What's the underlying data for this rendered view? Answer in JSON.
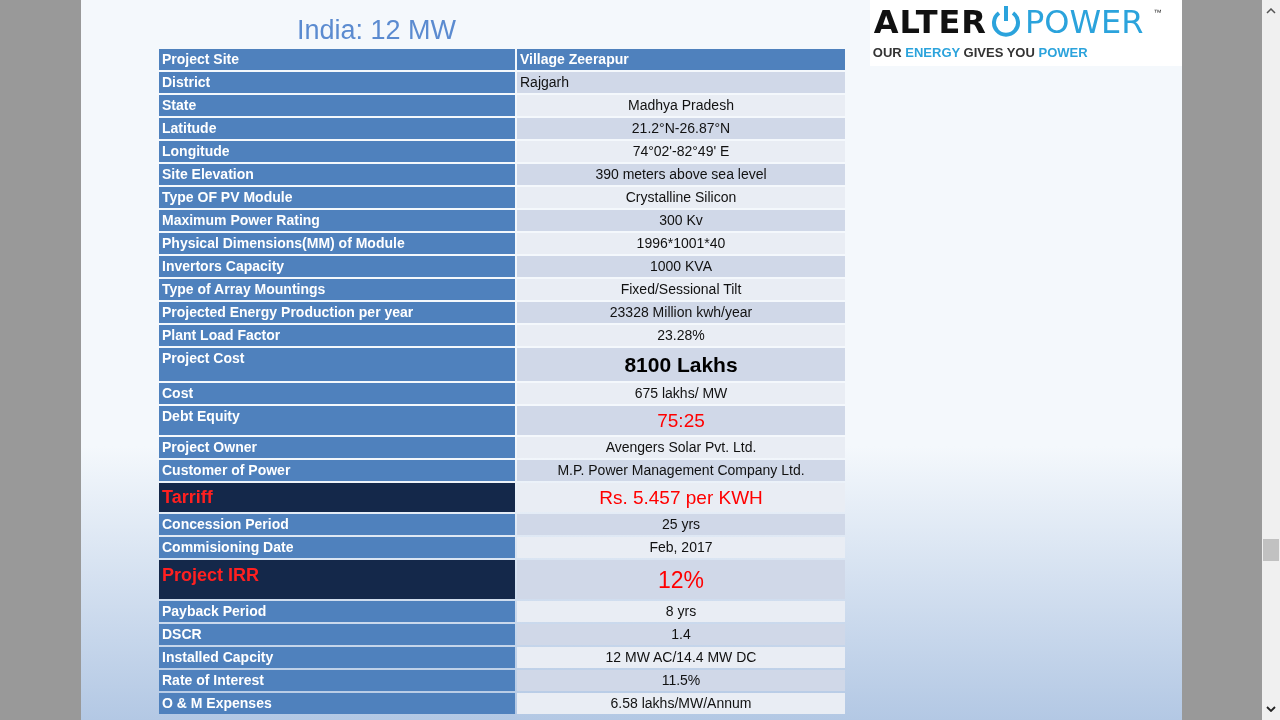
{
  "slide": {
    "title": "India: 12 MW",
    "logo": {
      "word_1": "ALTER",
      "word_2": "POWER",
      "trademark": "™",
      "tagline": [
        {
          "text": "OUR",
          "accent": false
        },
        {
          "text": "ENERGY",
          "accent": true
        },
        {
          "text": "GIVES YOU",
          "accent": false
        },
        {
          "text": "POWER",
          "accent": true
        }
      ]
    },
    "table": {
      "rows": [
        {
          "kind": "header",
          "label": "Project Site",
          "value": "Village Zeerapur"
        },
        {
          "kind": "left",
          "label": "District",
          "value": "Rajgarh"
        },
        {
          "kind": "normal",
          "label": "State",
          "value": "Madhya Pradesh"
        },
        {
          "kind": "normal",
          "label": "Latitude",
          "value": "21.2°N-26.87°N"
        },
        {
          "kind": "normal",
          "label": "Longitude",
          "value": "74°02'-82°49' E"
        },
        {
          "kind": "normal",
          "label": "Site Elevation",
          "value": "390 meters above sea level"
        },
        {
          "kind": "normal",
          "label": "Type OF PV Module",
          "value": "Crystalline Silicon"
        },
        {
          "kind": "normal",
          "label": "Maximum Power Rating",
          "value": "300 Kv"
        },
        {
          "kind": "normal",
          "label": "Physical Dimensions(MM) of Module",
          "value": "1996*1001*40"
        },
        {
          "kind": "normal",
          "label": "Invertors Capacity",
          "value": "1000 KVA"
        },
        {
          "kind": "normal",
          "label": "Type of Array Mountings",
          "value": "Fixed/Sessional Tilt"
        },
        {
          "kind": "normal",
          "label": "Projected Energy Production per year",
          "value": "23328 Million kwh/year"
        },
        {
          "kind": "normal",
          "label": "Plant Load Factor",
          "value": "23.28%"
        },
        {
          "kind": "big",
          "label": "Project Cost",
          "value": "8100 Lakhs"
        },
        {
          "kind": "normal",
          "label": "Cost",
          "value": "675 lakhs/ MW"
        },
        {
          "kind": "alert",
          "label": "Debt Equity",
          "value": "75:25"
        },
        {
          "kind": "normal",
          "label": "Project Owner",
          "value": "Avengers Solar Pvt. Ltd."
        },
        {
          "kind": "normal",
          "label": "Customer of Power",
          "value": "M.P. Power Management Company Ltd."
        },
        {
          "kind": "alert-both",
          "label": "Tarriff",
          "value": "Rs. 5.457 per KWH"
        },
        {
          "kind": "normal",
          "label": "Concession Period",
          "value": "25 yrs"
        },
        {
          "kind": "normal",
          "label": "Commisioning Date",
          "value": "Feb, 2017"
        },
        {
          "kind": "alert-big",
          "label": "Project IRR",
          "value": "12%"
        },
        {
          "kind": "normal",
          "label": "Payback Period",
          "value": "8 yrs"
        },
        {
          "kind": "normal",
          "label": "DSCR",
          "value": "1.4"
        },
        {
          "kind": "normal",
          "label": "Installed Capcity",
          "value": "12 MW AC/14.4 MW DC"
        },
        {
          "kind": "normal",
          "label": "Rate of Interest",
          "value": "11.5%"
        },
        {
          "kind": "normal",
          "label": "O & M Expenses",
          "value": "6.58  lakhs/MW/Annum"
        }
      ]
    }
  }
}
